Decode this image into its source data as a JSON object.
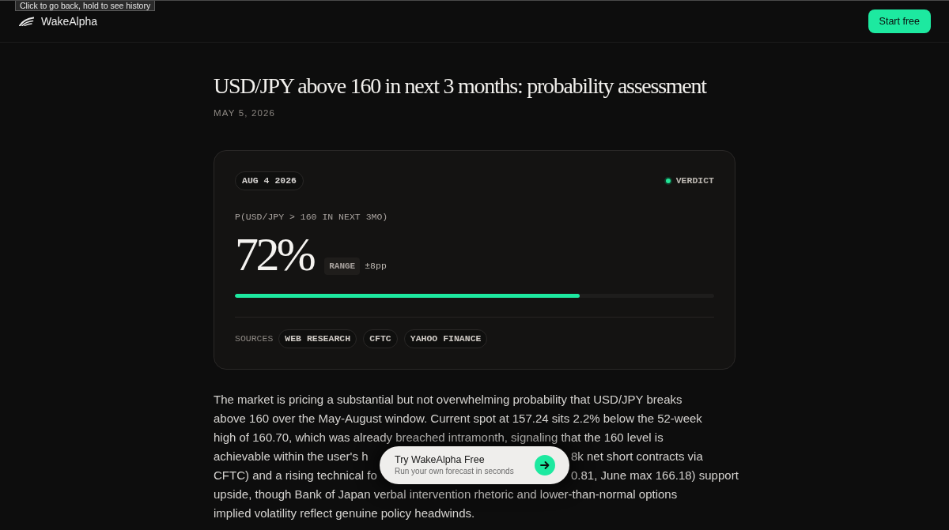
{
  "tooltip": {
    "text": "Click to go back, hold to see history"
  },
  "header": {
    "brand": "WakeAlpha",
    "cta": "Start free"
  },
  "article": {
    "title": "USD/JPY above 160 in next 3 months: probability assessment",
    "date": "MAY 5, 2026"
  },
  "card": {
    "date_badge": "AUG 4 2026",
    "status": "VERDICT",
    "question": "P(USD/JPY > 160 IN NEXT 3MO)",
    "probability": "72%",
    "range_label": "RANGE",
    "range_value": "±8pp",
    "level": 0.72,
    "sources_label": "SOURCES",
    "sources": [
      "WEB RESEARCH",
      "CFTC",
      "YAHOO FINANCE"
    ]
  },
  "body_lines": [
    {
      "kind": "full",
      "text": "The market is pricing a substantial but not overwhelming probability that USD/JPY breaks"
    },
    {
      "kind": "full",
      "text": "above 160 over the May-August window. Current spot at 157.24 sits 2.2% below the 52-week"
    },
    {
      "kind": "full",
      "text": "high of 160.70, which was already breached intramonth, signaling that the 160 level is"
    },
    {
      "kind": "split",
      "left": "achievable within the user's h",
      "right": "8k net short contracts via"
    },
    {
      "kind": "split",
      "left": "CFTC) and a rising technical fo",
      "right": "0.81, June max 166.18) support"
    },
    {
      "kind": "full",
      "text": "upside, though Bank of Japan verbal intervention rhetoric and lower-than-normal options"
    },
    {
      "kind": "full",
      "text": "implied volatility reflect genuine policy headwinds."
    }
  ],
  "floating_cta": {
    "title": "Try WakeAlpha Free",
    "subtitle": "Run your own forecast in seconds"
  }
}
